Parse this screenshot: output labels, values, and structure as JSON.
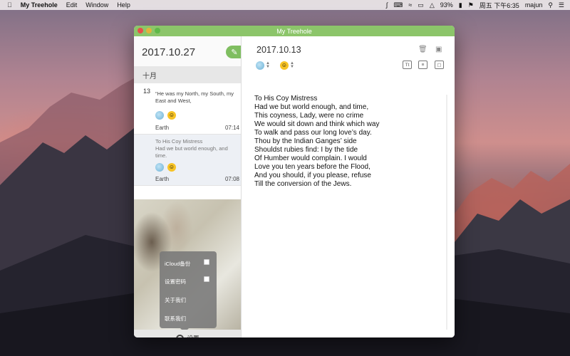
{
  "menubar": {
    "app_name": "My Treehole",
    "menus": [
      "Edit",
      "Window",
      "Help"
    ],
    "battery": "93%",
    "clock": "周五 下午6:35",
    "user": "majun"
  },
  "window": {
    "title": "My Treehole"
  },
  "sidebar": {
    "header_date": "2017.10.27",
    "month_label": "十月",
    "entries": [
      {
        "day": "13",
        "text": "“He was my North, my South, my East and West,",
        "location": "Earth",
        "time": "07:14",
        "weather_icon": "cloudy-sun-icon",
        "mood_icon": "grin-emoji-icon"
      },
      {
        "day": "",
        "text": "To His Coy Mistress\nHad we but world enough, and time.",
        "location": "Earth",
        "time": "07:08",
        "weather_icon": "cloudy-sun-icon",
        "mood_icon": "tongue-emoji-icon"
      }
    ],
    "settings_menu": {
      "items": [
        "iCloud备份",
        "设置密码",
        "关于我们",
        "联系我们"
      ]
    },
    "footer_label": "设置"
  },
  "main": {
    "date": "2017.10.13",
    "poem": "To His Coy Mistress\nHad we but world enough, and time,\nThis coyness, Lady, were no crime\nWe would sit down and think which way\nTo walk and pass our long love’s day.\nThou by the Indian Ganges’ side\nShouldst rubies find: I by the tide\nOf Humber would complain. I would\nLove you ten years before the Flood,\nAnd you should, if you please, refuse\nTill the conversion of the Jews."
  },
  "colors": {
    "accent_green": "#8cc56a",
    "compose_green": "#7fbe60"
  }
}
